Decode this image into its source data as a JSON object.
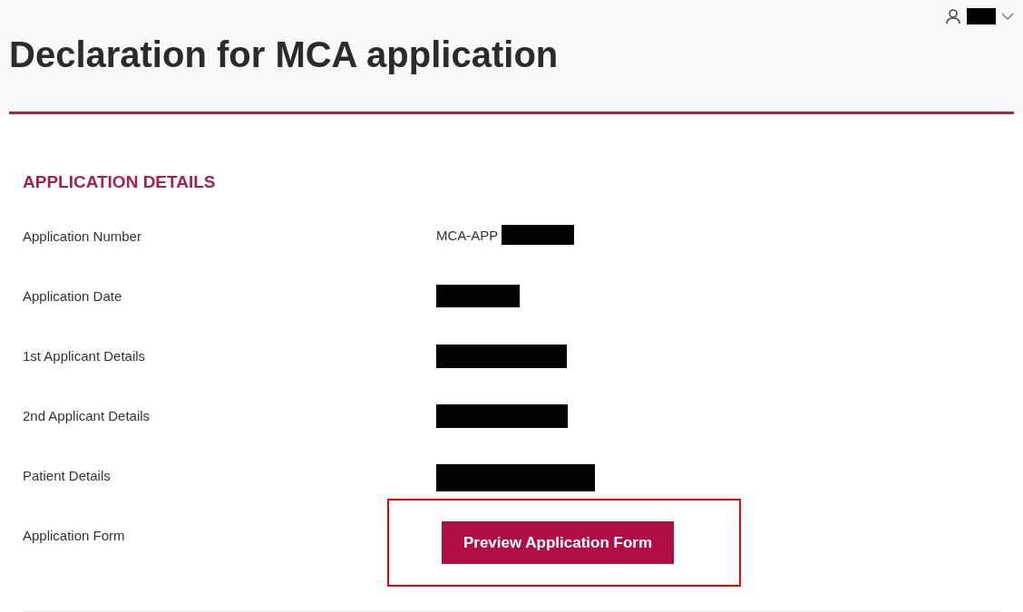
{
  "header": {
    "title": "Declaration for MCA application",
    "user_menu": {
      "name": {
        "kind": "redacted"
      }
    }
  },
  "section": {
    "heading": "APPLICATION DETAILS",
    "rows": [
      {
        "label": "Application Number",
        "value": [
          {
            "kind": "text",
            "text": "MCA-APP"
          },
          {
            "kind": "redacted"
          }
        ]
      },
      {
        "label": "Application Date",
        "value": [
          {
            "kind": "redacted"
          }
        ]
      },
      {
        "label": "1st Applicant Details",
        "value": [
          {
            "kind": "redacted"
          }
        ]
      },
      {
        "label": "2nd Applicant Details",
        "value": [
          {
            "kind": "redacted"
          }
        ]
      },
      {
        "label": "Patient Details",
        "value": [
          {
            "kind": "redacted"
          }
        ]
      },
      {
        "label": "Application Form",
        "value": [
          {
            "kind": "button",
            "text": "Preview Application Form",
            "highlighted": true
          }
        ]
      }
    ]
  }
}
